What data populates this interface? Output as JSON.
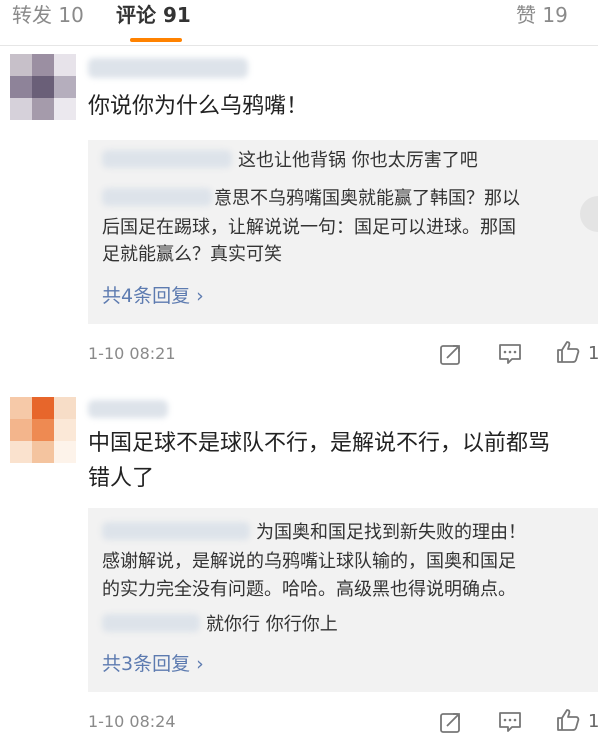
{
  "tabs": {
    "repost": "转发 10",
    "comments": "评论 91",
    "likes": "赞 19"
  },
  "comments": [
    {
      "text": "你说你为什么乌鸦嘴！",
      "replies": [
        "这也让他背锅 你也太厉害了吧",
        "意思不乌鸦嘴国奥就能赢了韩国？那以",
        "后国足在踢球，让解说说一句：国足可以进球。那国",
        "足就能赢么？真实可笑"
      ],
      "reply_count": "共4条回复 ›",
      "time": "1-10 08:21",
      "like_count": "1"
    },
    {
      "text_line1": "中国足球不是球队不行，是解说不行，以前都骂",
      "text_line2": "错人了",
      "replies": [
        "为国奥和国足找到新失败的理由！",
        "感谢解说，是解说的乌鸦嘴让球队输的，国奥和国足",
        "的实力完全没有问题。哈哈。高级黑也得说明确点。",
        "就你行 你行你上"
      ],
      "reply_count": "共3条回复 ›",
      "time": "1-10 08:24",
      "like_count": "1"
    }
  ],
  "icons": {
    "repost": "repost-icon",
    "comment": "comment-icon",
    "like": "thumbs-up-icon"
  },
  "colors": {
    "accent_orange": "#ff8200",
    "link_blue": "#5d7bb0",
    "reply_bg": "#f2f2f2"
  }
}
